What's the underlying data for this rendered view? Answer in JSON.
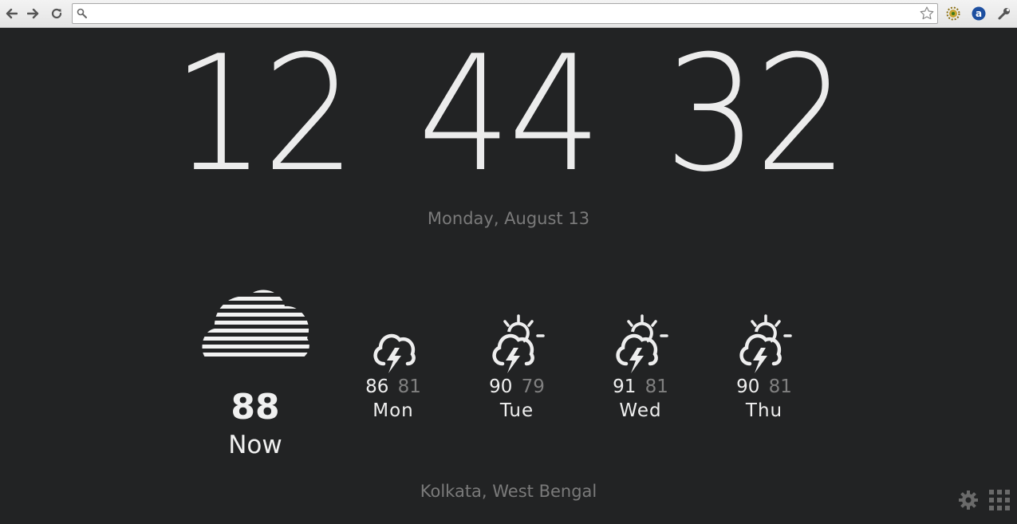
{
  "browser": {
    "address_value": "",
    "icons": [
      "back-icon",
      "forward-icon",
      "reload-icon",
      "search-icon",
      "bookmark-star-icon",
      "extension-icon",
      "amazon-extension-icon",
      "wrench-menu-icon"
    ]
  },
  "clock": {
    "hours": "12",
    "minutes": "44",
    "seconds": "32"
  },
  "date": "Monday, August 13",
  "weather": {
    "now": {
      "temp": "88",
      "label": "Now",
      "icon": "fog-cloud-icon"
    },
    "forecast": [
      {
        "high": "86",
        "low": "81",
        "day": "Mon",
        "icon": "thunderstorm-icon"
      },
      {
        "high": "90",
        "low": "79",
        "day": "Tue",
        "icon": "sun-thunderstorm-icon"
      },
      {
        "high": "91",
        "low": "81",
        "day": "Wed",
        "icon": "sun-thunderstorm-icon"
      },
      {
        "high": "90",
        "low": "81",
        "day": "Thu",
        "icon": "sun-thunderstorm-icon"
      }
    ]
  },
  "location": "Kolkata, West Bengal",
  "colors": {
    "background": "#222324",
    "primary_text": "#ececec",
    "muted_text": "#7a7a7a"
  }
}
